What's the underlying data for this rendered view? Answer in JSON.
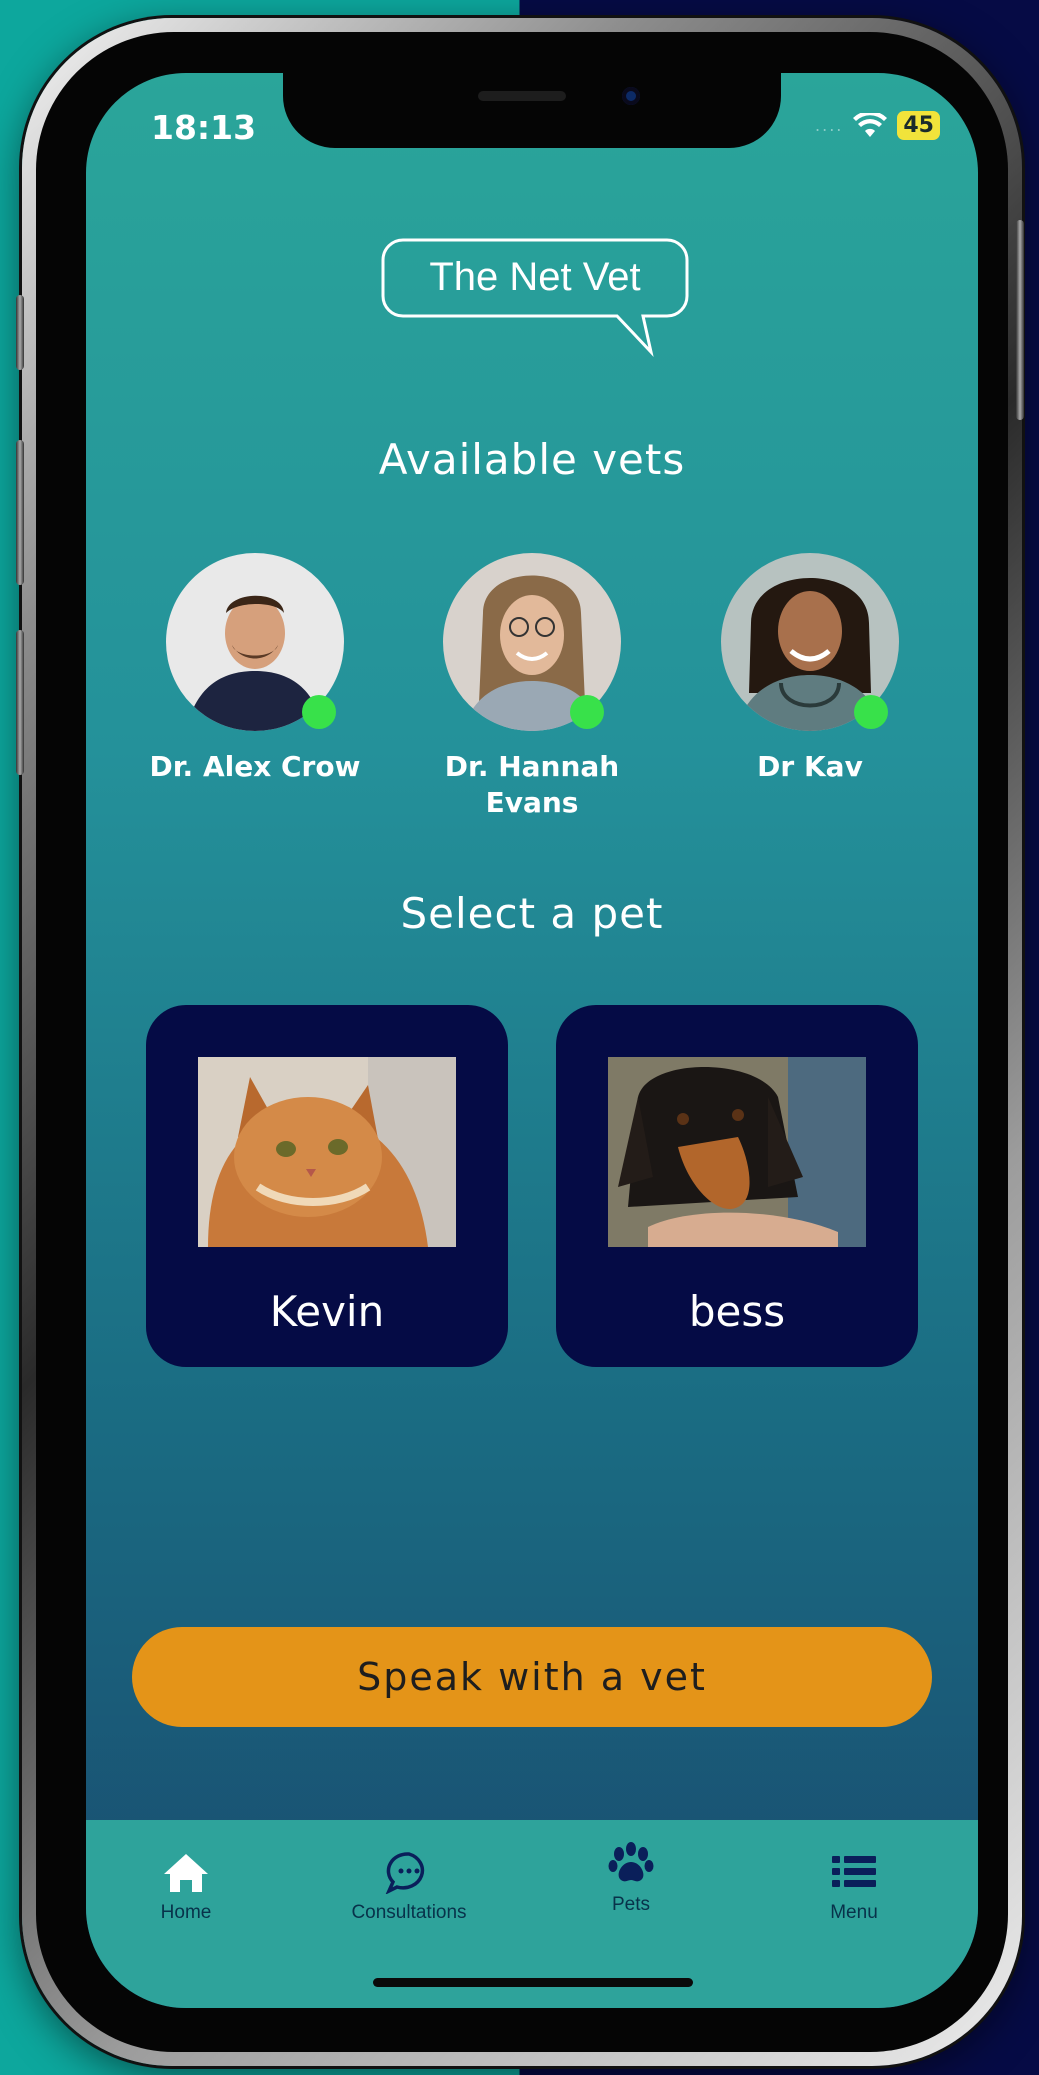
{
  "status_bar": {
    "time": "18:13",
    "battery": "45",
    "signal": "...."
  },
  "logo": {
    "text": "The Net Vet"
  },
  "vets_section": {
    "title": "Available vets",
    "vets": [
      {
        "name": "Dr. Alex Crow",
        "online": true
      },
      {
        "name": "Dr. Hannah Evans",
        "online": true
      },
      {
        "name": "Dr Kav",
        "online": true
      }
    ]
  },
  "pets_section": {
    "title": "Select a pet",
    "pets": [
      {
        "name": "Kevin"
      },
      {
        "name": "bess"
      }
    ]
  },
  "cta": {
    "label": "Speak with a vet"
  },
  "tab_bar": {
    "tabs": [
      {
        "label": "Home",
        "icon": "home-icon"
      },
      {
        "label": "Consultations",
        "icon": "chat-icon"
      },
      {
        "label": "Pets",
        "icon": "paw-icon"
      },
      {
        "label": "Menu",
        "icon": "list-icon"
      }
    ]
  },
  "colors": {
    "accent": "#e49418",
    "card": "#050b45",
    "online": "#38e14a",
    "tabbar": "#2ea39b"
  }
}
